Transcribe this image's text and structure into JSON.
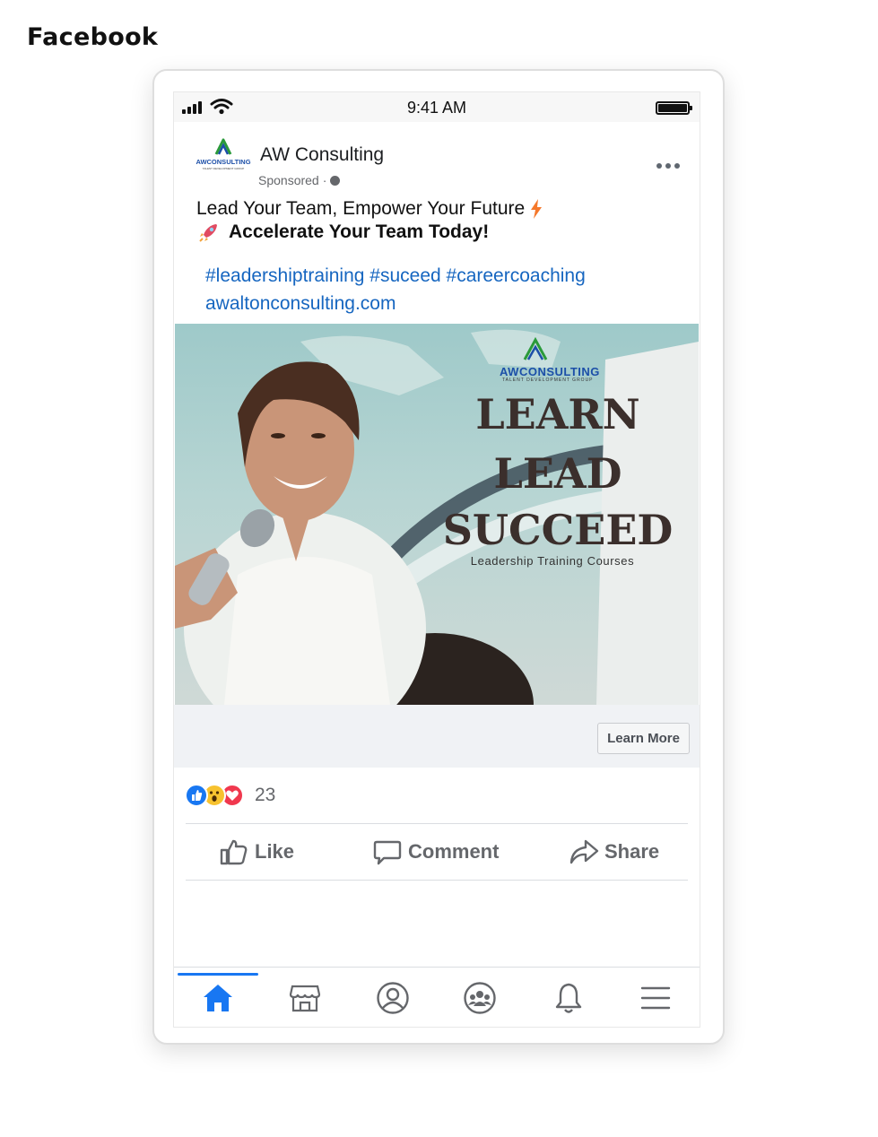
{
  "page_label": "Facebook",
  "status_bar": {
    "time": "9:41 AM"
  },
  "post": {
    "page_name": "AW Consulting",
    "sponsored": "Sponsored",
    "separator": "·",
    "line1": "Lead Your Team, Empower Your Future",
    "line2": "Accelerate Your Team Today!",
    "hashtags": "#leadershiptraining #suceed #careercoaching",
    "link": "awaltonconsulting.com"
  },
  "ad_image": {
    "logo_text": "AWCONSULTING",
    "logo_subtext": "TALENT DEVELOPMENT GROUP",
    "headline_1": "LEARN",
    "headline_2": "LEAD",
    "headline_3": "SUCCEED",
    "tagline": "Leadership Training Courses"
  },
  "cta": {
    "label": "Learn More"
  },
  "reactions": {
    "count": "23",
    "types": [
      "like",
      "wow",
      "love"
    ]
  },
  "actions": {
    "like": "Like",
    "comment": "Comment",
    "share": "Share"
  },
  "tab_bar": {
    "active": "home",
    "tabs": [
      "home-icon",
      "marketplace-icon",
      "profile-icon",
      "groups-icon",
      "notifications-icon",
      "menu-icon"
    ]
  },
  "colors": {
    "brand_blue": "#1877f2",
    "link_blue": "#1666c0",
    "ad_headline": "#3b2f2c"
  }
}
